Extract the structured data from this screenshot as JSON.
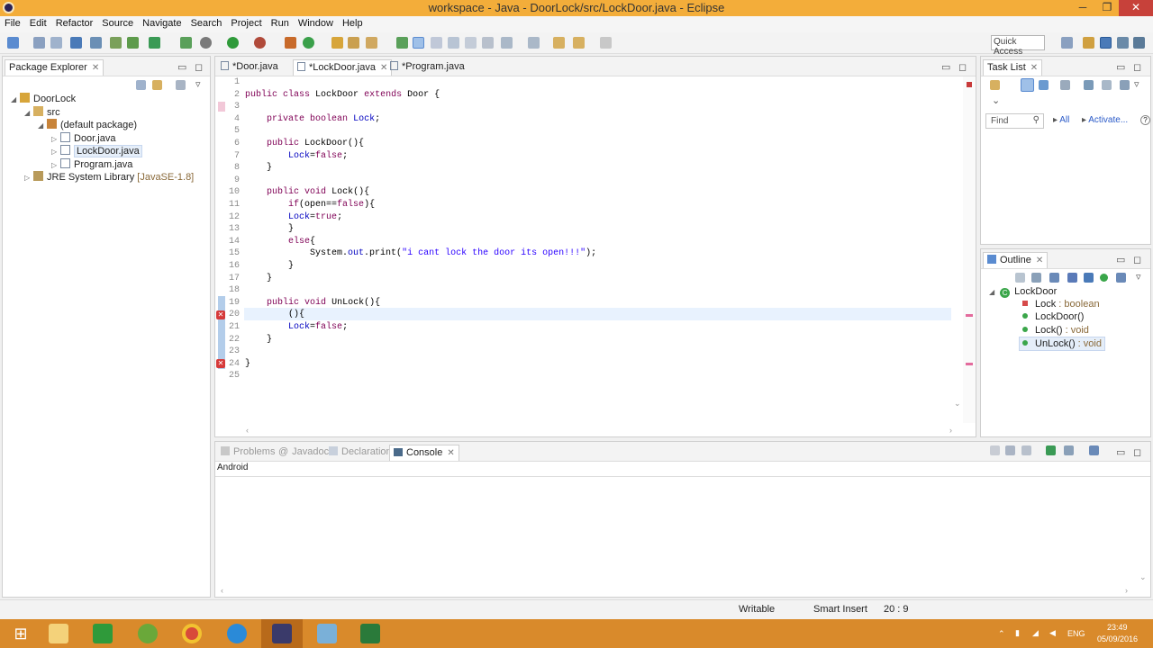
{
  "window": {
    "title": "workspace - Java - DoorLock/src/LockDoor.java - Eclipse",
    "controls": [
      "─",
      "❐",
      "✕"
    ]
  },
  "menu": [
    "File",
    "Edit",
    "Refactor",
    "Source",
    "Navigate",
    "Search",
    "Project",
    "Run",
    "Window",
    "Help"
  ],
  "toolbar": {
    "quick_access": "Quick Access"
  },
  "package_explorer": {
    "tab": "Package Explorer",
    "tree": [
      {
        "label": "DoorLock",
        "level": 0
      },
      {
        "label": "src",
        "level": 1
      },
      {
        "label": "(default package)",
        "level": 2
      },
      {
        "label": "Door.java",
        "level": 3
      },
      {
        "label": "LockDoor.java",
        "level": 3,
        "selected": true
      },
      {
        "label": "Program.java",
        "level": 3
      },
      {
        "label": "JRE System Library",
        "suffix": "[JavaSE-1.8]",
        "level": 1
      }
    ]
  },
  "editor": {
    "tabs": [
      "*Door.java",
      "*LockDoor.java",
      "*Program.java"
    ],
    "active_tab": 1,
    "lines": [
      "",
      "public class LockDoor extends Door {",
      "",
      "    private boolean Lock;",
      "",
      "    public LockDoor(){",
      "        Lock=false;",
      "    }",
      "",
      "    public void Lock(){",
      "        if(open==false){",
      "        Lock=true;",
      "        }",
      "        else{",
      "            System.out.print(\"i cant lock the door its open!!!\");",
      "        }",
      "    }",
      "",
      "    public void UnLock(){",
      "        (){",
      "        Lock=false;",
      "    }",
      "",
      "}",
      ""
    ],
    "error_lines": [
      20,
      24
    ]
  },
  "task_list": {
    "tab": "Task List",
    "find_placeholder": "Find",
    "all": "All",
    "activate": "Activate..."
  },
  "outline": {
    "tab": "Outline",
    "class_name": "LockDoor",
    "members": [
      {
        "name": "Lock",
        "type": " : boolean",
        "kind": "field"
      },
      {
        "name": "LockDoor()",
        "type": "",
        "kind": "constructor"
      },
      {
        "name": "Lock()",
        "type": " : void",
        "kind": "method"
      },
      {
        "name": "UnLock()",
        "type": " : void",
        "kind": "method",
        "selected": true
      }
    ]
  },
  "bottom_panel": {
    "tabs": [
      "Problems",
      "Javadoc",
      "Declaration",
      "Console"
    ],
    "active_tab": "Console",
    "console_text": "Android"
  },
  "status": {
    "writable": "Writable",
    "insert_mode": "Smart Insert",
    "position": "20 : 9"
  },
  "taskbar": {
    "lang": "ENG",
    "time": "23:49",
    "date": "05/09/2016"
  },
  "colors": {
    "titlebar": "#f3ad3a",
    "taskbar": "#d98a2b",
    "keyword": "#7f0055",
    "string": "#2a00ff",
    "field": "#0000c0"
  }
}
